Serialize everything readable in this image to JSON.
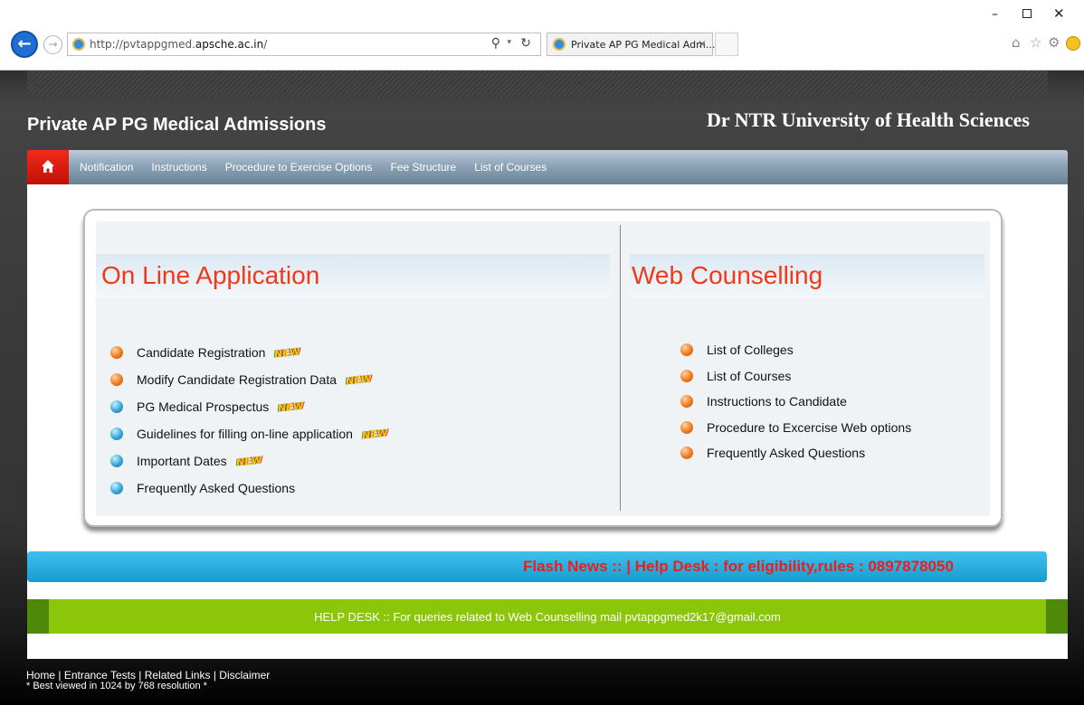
{
  "browser": {
    "url_prefix": "http://pvtappgmed.",
    "url_domain": "apsche.ac.in",
    "url_suffix": "/",
    "tab_title": "Private AP PG Medical Adm...",
    "back_icon": "back-arrow-icon",
    "window_controls": {
      "minimize": "–",
      "close": "✕"
    },
    "search_glyph": "⚲",
    "dropdown_glyph": "▾",
    "refresh_glyph": "↻",
    "tab_close_glyph": "✕",
    "home_glyph": "⌂",
    "favorites_glyph": "☆",
    "settings_glyph": "⚙"
  },
  "header": {
    "site_title": "Private AP PG Medical Admissions",
    "university": "Dr NTR University of Health Sciences"
  },
  "nav": {
    "items": [
      "Notification",
      "Instructions",
      "Procedure to Exercise Options",
      "Fee Structure",
      "List of Courses"
    ]
  },
  "online_application": {
    "title": "On Line Application",
    "links": [
      {
        "label": "Candidate Registration",
        "bullet": "orange",
        "new": true
      },
      {
        "label": "Modify Candidate Registration Data",
        "bullet": "orange",
        "new": true
      },
      {
        "label": "PG Medical Prospectus",
        "bullet": "blue",
        "new": true
      },
      {
        "label": "Guidelines for filling on-line application",
        "bullet": "blue",
        "new": true
      },
      {
        "label": "Important Dates",
        "bullet": "blue",
        "new": true
      },
      {
        "label": "Frequently Asked Questions",
        "bullet": "blue",
        "new": false
      }
    ]
  },
  "web_counselling": {
    "title": "Web Counselling",
    "links": [
      {
        "label": "List of Colleges",
        "bullet": "orange"
      },
      {
        "label": "List of Courses",
        "bullet": "orange"
      },
      {
        "label": "Instructions to Candidate",
        "bullet": "orange"
      },
      {
        "label": "Procedure to Excercise Web options",
        "bullet": "orange"
      },
      {
        "label": "Frequently Asked Questions",
        "bullet": "orange"
      }
    ]
  },
  "new_badge": "NEW",
  "flash_news": "Flash News ::   |   Help Desk : for eligibility,rules : 0897878050",
  "helpdesk": "HELP DESK :: For queries related to Web Counselling mail pvtappgmed2k17@gmail.com",
  "footer": {
    "links": [
      "Home",
      "Entrance Tests",
      "Related Links",
      "Disclaimer"
    ],
    "separator": " | ",
    "note": "* Best viewed in 1024 by 768 resolution *"
  },
  "colors": {
    "section_title": "#ee3a1a",
    "flash_text": "#ee1c1c",
    "helpdesk_bg": "#8bc60b",
    "home_button": "#e21d10"
  }
}
